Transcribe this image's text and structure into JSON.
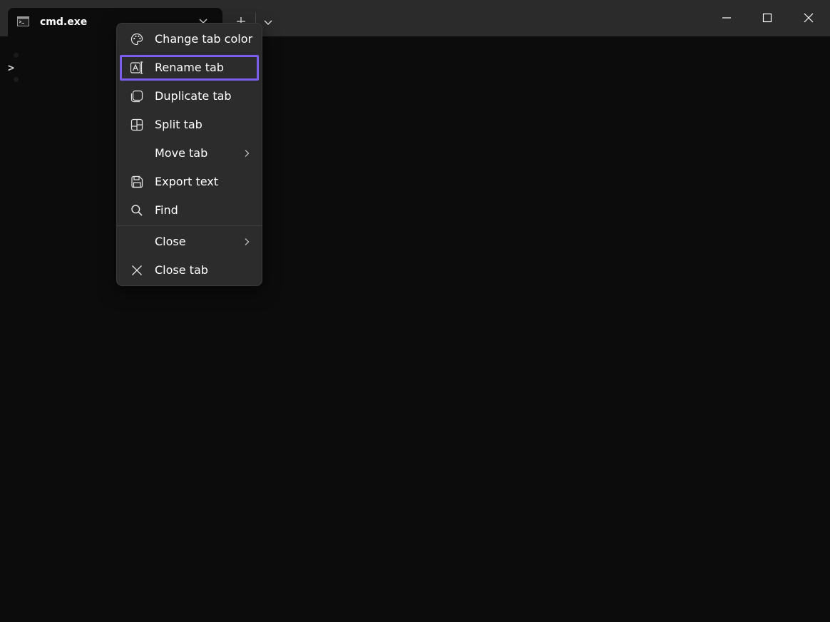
{
  "window": {
    "tab": {
      "title": "cmd.exe",
      "icon": "terminal-icon"
    },
    "titlebar_buttons": {
      "new_tab": "plus-icon",
      "dropdown": "chevron-down-icon",
      "minimize": "minimize-icon",
      "maximize": "maximize-icon",
      "close": "close-icon"
    }
  },
  "terminal": {
    "prompt": ">",
    "background": "#0c0c0c"
  },
  "context_menu": {
    "items": [
      {
        "label": "Change tab color",
        "icon": "palette-icon"
      },
      {
        "label": "Rename tab",
        "icon": "rename-icon",
        "focused": true
      },
      {
        "label": "Duplicate tab",
        "icon": "duplicate-icon"
      },
      {
        "label": "Split tab",
        "icon": "split-icon"
      },
      {
        "label": "Move tab",
        "icon": "",
        "submenu": true
      },
      {
        "label": "Export text",
        "icon": "save-icon"
      },
      {
        "label": "Find",
        "icon": "search-icon"
      },
      {
        "label": "Close",
        "icon": "",
        "submenu": true
      },
      {
        "label": "Close tab",
        "icon": "close-icon"
      }
    ],
    "focus_color": "#7b5ef0"
  }
}
